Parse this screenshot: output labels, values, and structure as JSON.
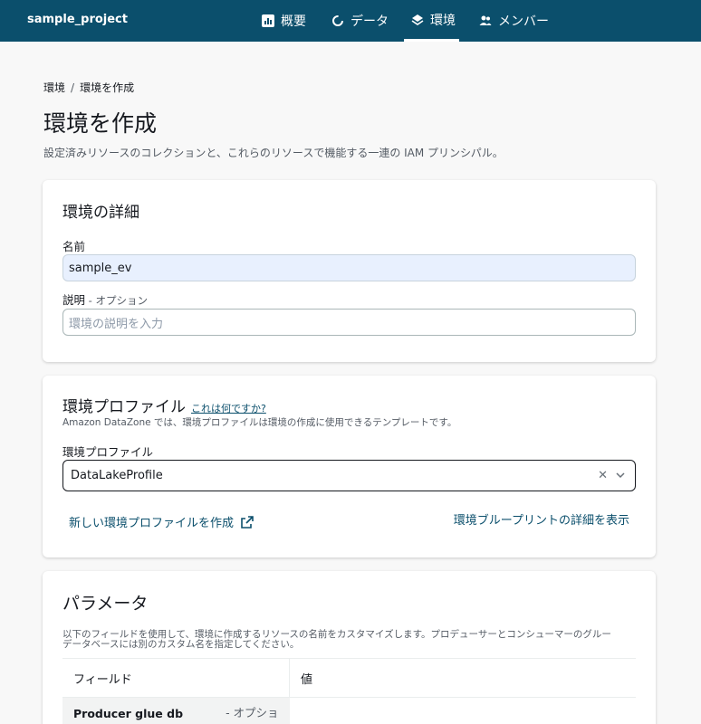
{
  "header": {
    "project": "sample_project",
    "nav": [
      {
        "label": "概要",
        "icon": "chart-icon"
      },
      {
        "label": "データ",
        "icon": "circle-icon"
      },
      {
        "label": "環境",
        "icon": "layers-icon"
      },
      {
        "label": "メンバー",
        "icon": "users-icon"
      }
    ],
    "active_index": 2
  },
  "breadcrumb": {
    "parent": "環境",
    "separator": "/",
    "current": "環境を作成"
  },
  "page": {
    "title": "環境を作成",
    "description": "設定済みリソースのコレクションと、これらのリソースで機能する一連の IAM プリンシパル。"
  },
  "details": {
    "title": "環境の詳細",
    "name_label": "名前",
    "name_value": "sample_ev",
    "desc_label": "説明",
    "desc_optional": " - オプション",
    "desc_placeholder": "環境の説明を入力"
  },
  "profile": {
    "title": "環境プロファイル",
    "info_link": "これは何ですか?",
    "description": "Amazon DataZone では、環境プロファイルは環境の作成に使用できるテンプレートです。",
    "field_label": "環境プロファイル",
    "selected": "DataLakeProfile",
    "create_link": "新しい環境プロファイルを作成",
    "blueprint_link": "環境ブループリントの詳細を表示"
  },
  "params": {
    "title": "パラメータ",
    "description_line1": "以下のフィールドを使用して、環境に作成するリソースの名前をカスタマイズします。プロデューサーとコンシューマーのグルー",
    "description_line2": "データベースには別のカスタム名を指定してください。",
    "columns": [
      "フィールド",
      "値"
    ],
    "rows": [
      {
        "field": "Producer glue db name",
        "optional": " - オプション",
        "value": ""
      }
    ]
  },
  "colors": {
    "header_bg": "#0b4f6c",
    "link": "#0b4f6c",
    "input_fill": "#e8f0fe"
  }
}
